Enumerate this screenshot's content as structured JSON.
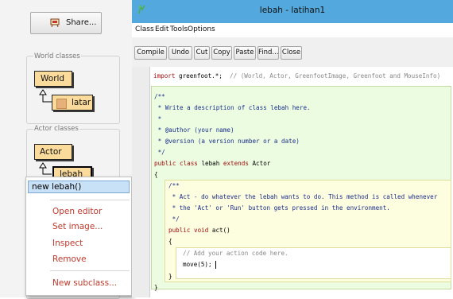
{
  "left_panel": {
    "share_label": "Share...",
    "world_group_title": "World classes",
    "actor_group_title": "Actor classes",
    "world_class": "World",
    "latar_class": "latar",
    "actor_class": "Actor",
    "lebah_class": "lebah"
  },
  "context_menu": {
    "items": [
      "new lebah()",
      "Open editor",
      "Set image...",
      "Inspect",
      "Remove",
      "New subclass..."
    ]
  },
  "editor": {
    "title": "lebah - latihan1",
    "menus": [
      "Class",
      "Edit",
      "Tools",
      "Options"
    ],
    "toolbar": [
      "Compile",
      "Undo",
      "Cut",
      "Copy",
      "Paste",
      "Find...",
      "Close"
    ],
    "code": {
      "import_kw": "import",
      "import_rest": " greenfoot.*;",
      "import_comment": "  // (World, Actor, GreenfootImage, Greenfoot and MouseInfo)",
      "doc1": "/**",
      "doc2": " * Write a description of class lebah here.",
      "doc3": " *",
      "doc4": " * @author (your name)",
      "doc5": " * @version (a version number or a date)",
      "doc6": " */",
      "cls_public": "public",
      "cls_class": "class",
      "cls_name": " lebah ",
      "cls_extends": "extends",
      "cls_actor": " Actor",
      "open_brace": "{",
      "m_doc1": "/**",
      "m_doc2": " * Act - do whatever the lebah wants to do. This method is called whenever",
      "m_doc3": " * the 'Act' or 'Run' button gets pressed in the environment.",
      "m_doc4": " */",
      "m_public": "public",
      "m_void": "void",
      "m_name": " act()",
      "m_open": "{",
      "body_comment": "// Add your action code here.",
      "body_stmt": "move(5);",
      "m_close": "}",
      "close_brace": "}"
    }
  },
  "colors": {
    "title_bar": "#53a8dd",
    "class_scope": "#ebfce0",
    "method_scope": "#fdfddf",
    "class_box": "#fadb9b",
    "menu_highlight": "#c9e1f7"
  }
}
